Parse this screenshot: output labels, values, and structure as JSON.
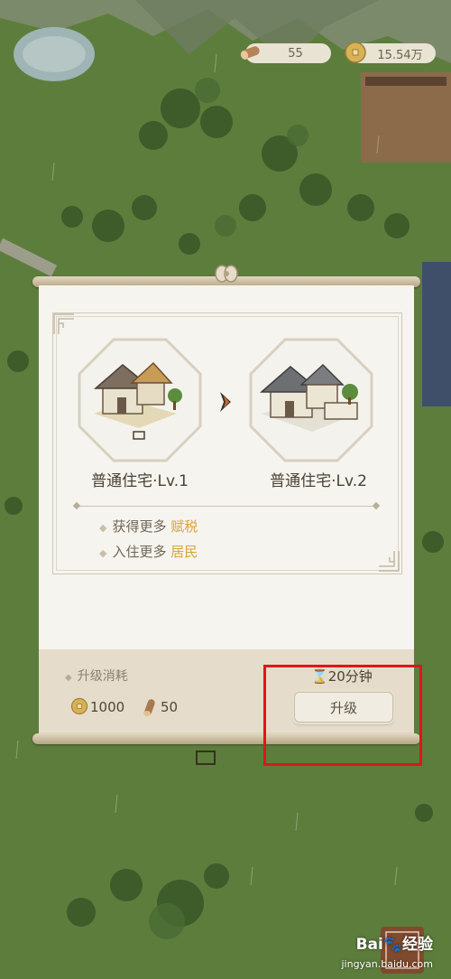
{
  "resources": {
    "wood": "55",
    "coins": "15.54万"
  },
  "upgrade": {
    "from": {
      "name": "普通住宅·Lv.1"
    },
    "to": {
      "name": "普通住宅·Lv.2"
    },
    "benefits": [
      {
        "prefix": "获得更多",
        "highlight": "赋税"
      },
      {
        "prefix": "入住更多",
        "highlight": "居民"
      }
    ],
    "cost_title": "升级消耗",
    "cost_coins": "1000",
    "cost_wood": "50",
    "time": "20分钟",
    "button_label": "升级"
  },
  "colors": {
    "highlight_text": "#d9a53a",
    "annotation_box": "#e0141b",
    "grass": "#5d7d3c"
  },
  "icons": [
    "wood-log-icon",
    "gold-coin-icon",
    "arrow-right-icon",
    "hourglass-icon"
  ],
  "watermark": {
    "brand": "Bai",
    "brand_suffix": "经验",
    "url": "jingyan.baidu.com"
  }
}
